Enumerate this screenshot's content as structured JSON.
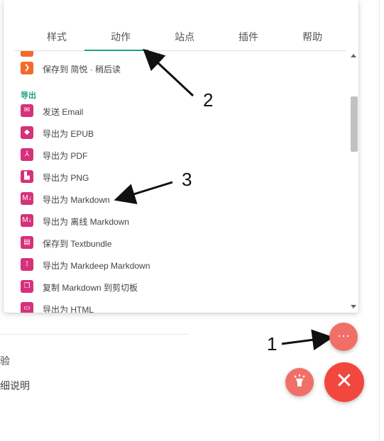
{
  "tabs": [
    "样式",
    "动作",
    "站点",
    "插件",
    "帮助"
  ],
  "active_tab": "动作",
  "items_top": [
    {
      "label": "保存到 简悦 · 稍后读",
      "icon": "chevron-right-icon"
    }
  ],
  "section_export": "导出",
  "items_export": [
    {
      "label": "发送 Email",
      "icon": "mail-icon"
    },
    {
      "label": "导出为 EPUB",
      "icon": "epub-icon"
    },
    {
      "label": "导出为 PDF",
      "icon": "pdf-icon"
    },
    {
      "label": "导出为 PNG",
      "icon": "png-icon"
    },
    {
      "label": "导出为 Markdown",
      "icon": "markdown-icon"
    },
    {
      "label": "导出为 离线 Markdown",
      "icon": "offline-markdown-icon"
    },
    {
      "label": "保存到 Textbundle",
      "icon": "textbundle-icon"
    },
    {
      "label": "导出为 Markdeep Markdown",
      "icon": "markdeep-icon"
    },
    {
      "label": "复制 Markdown 到剪切板",
      "icon": "copy-icon"
    },
    {
      "label": "导出为 HTML",
      "icon": "html-icon"
    }
  ],
  "background_text": [
    "验",
    "细说明"
  ],
  "annotations": [
    "1",
    "2",
    "3"
  ],
  "fab": {
    "more_symbol": "···",
    "close_symbol": "✕"
  },
  "colors": {
    "accent": "#1f9e83",
    "icon_pink": "#d6317a",
    "icon_orange": "#f56a2a",
    "fab_red": "#f2473f",
    "fab_light": "#f07068"
  }
}
